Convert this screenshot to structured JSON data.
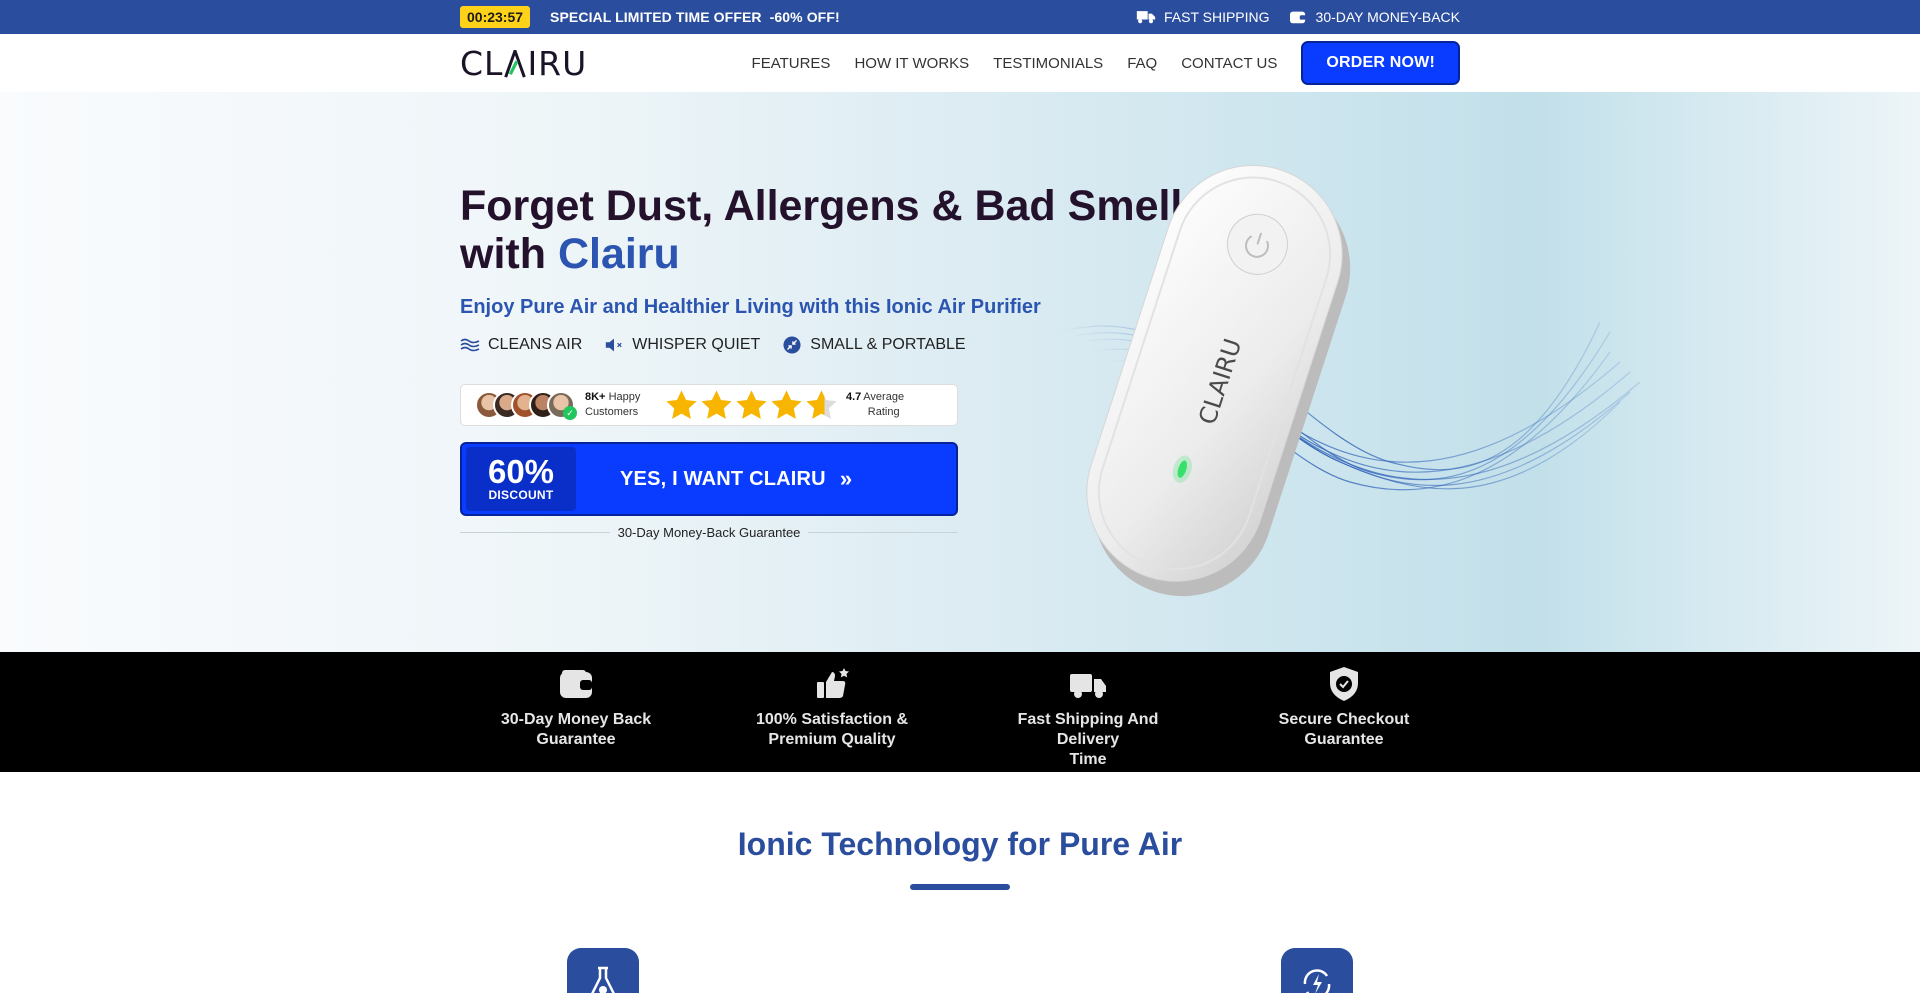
{
  "topbar": {
    "timer": "00:23:57",
    "offer_text": "SPECIAL LIMITED TIME OFFER",
    "offer_discount": "-60% OFF!",
    "shipping": "FAST SHIPPING",
    "moneyback": "30-DAY MONEY-BACK"
  },
  "header": {
    "logo_part1": "CL",
    "logo_part2": "IRU",
    "nav": [
      "FEATURES",
      "HOW IT WORKS",
      "TESTIMONIALS",
      "FAQ",
      "CONTACT US"
    ],
    "order_button": "ORDER NOW!"
  },
  "hero": {
    "title_line1": "Forget Dust, Allergens & Bad Smells",
    "title_with": "with",
    "title_brand": "Clairu",
    "subtitle": "Enjoy Pure Air and Healthier Living with this Ionic Air Purifier",
    "features": [
      "CLEANS AIR",
      "WHISPER QUIET",
      "SMALL & PORTABLE"
    ],
    "rating": {
      "customers_count": "8K+",
      "customers_label_1": "Happy",
      "customers_label_2": "Customers",
      "stars": 4.7,
      "value": "4.7",
      "label_1": "Average",
      "label_2": "Rating"
    },
    "cta": {
      "discount_pct": "60%",
      "discount_label": "DISCOUNT",
      "text": "YES, I WANT CLAIRU",
      "arrows": "»"
    },
    "guarantee": "30-Day Money-Back Guarantee",
    "device_brand": "CLAIRU"
  },
  "trust": [
    {
      "icon": "wallet-icon",
      "line1": "30-Day Money Back",
      "line2": "Guarantee"
    },
    {
      "icon": "thumbs-up-icon",
      "line1": "100% Satisfaction &",
      "line2": "Premium Quality"
    },
    {
      "icon": "truck-icon",
      "line1": "Fast Shipping And Delivery",
      "line2": "Time"
    },
    {
      "icon": "shield-check-icon",
      "line1": "Secure Checkout",
      "line2": "Guarantee"
    }
  ],
  "section": {
    "title": "Ionic Technology for Pure Air"
  },
  "colors": {
    "brand_blue": "#2b4d9e",
    "cta_blue": "#0a3cff",
    "timer_yellow": "#ffd21a",
    "star_yellow": "#f7b500",
    "accent_green": "#22c55e"
  }
}
